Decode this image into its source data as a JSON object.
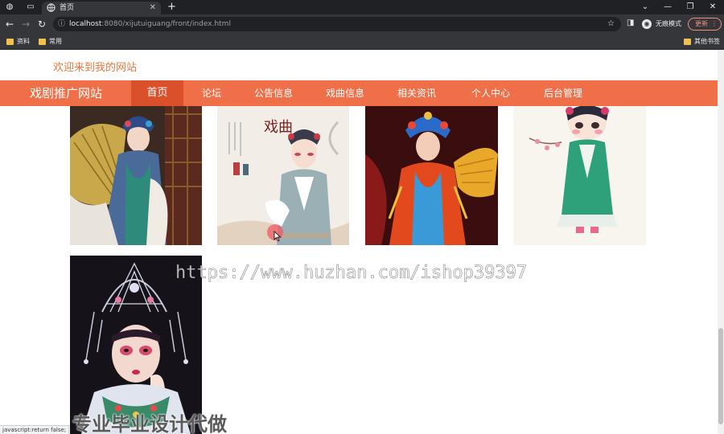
{
  "browser": {
    "tab_title": "首页",
    "url_host": "localhost",
    "url_rest": ":8080/xijutuiguang/front/index.html",
    "profile_label": "无痕模式",
    "update_label": "更新",
    "bookmarks": [
      "资料",
      "常用"
    ],
    "other_bookmarks": "其他书签",
    "status_text": "javascript:return false;"
  },
  "page": {
    "welcome": "欢迎来到我的网站",
    "site_name": "戏剧推广网站",
    "nav": [
      {
        "label": "首页",
        "active": true
      },
      {
        "label": "论坛"
      },
      {
        "label": "公告信息"
      },
      {
        "label": "戏曲信息"
      },
      {
        "label": "相关资讯"
      },
      {
        "label": "个人中心"
      },
      {
        "label": "后台管理"
      }
    ],
    "poster_title": "戏曲"
  },
  "overlay": {
    "watermark": "https://www.huzhan.com/ishop39397",
    "promo": "专业毕业设计代做"
  },
  "colors": {
    "accent": "#ef6f49",
    "accent_dark": "#d9502b",
    "welcome_text": "#e8783e"
  }
}
